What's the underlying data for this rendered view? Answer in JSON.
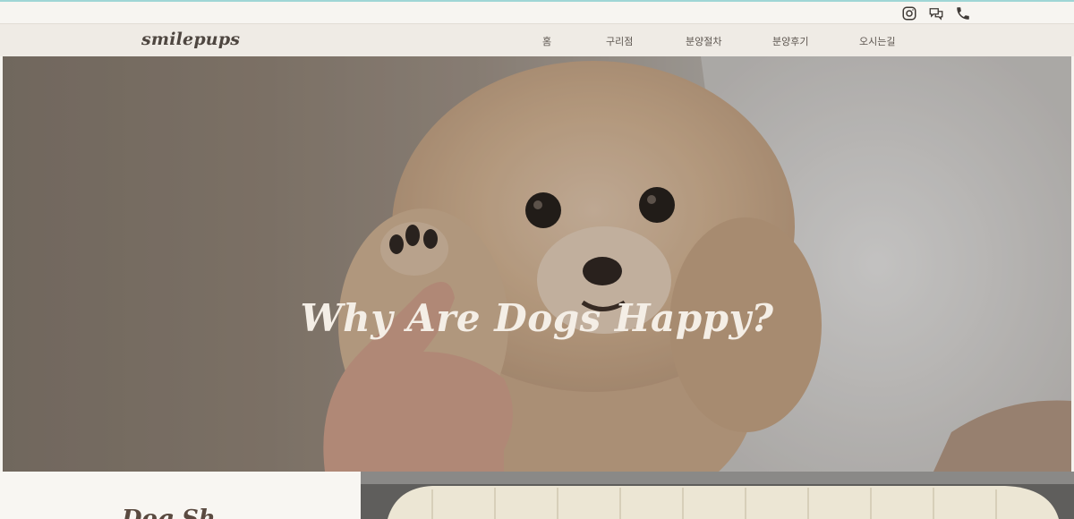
{
  "topbar": {
    "icons": [
      "instagram-icon",
      "chat-icon",
      "phone-icon"
    ]
  },
  "nav": {
    "logo": "smilepups",
    "items": [
      {
        "label": "홈"
      },
      {
        "label": "구리점"
      },
      {
        "label": "분양절차"
      },
      {
        "label": "분양후기"
      },
      {
        "label": "오시는길"
      }
    ]
  },
  "hero": {
    "title": "Why Are Dogs Happy?"
  },
  "section": {
    "heading_partial": "Dog Sh"
  },
  "colors": {
    "nav_bg": "#efebe5",
    "page_bg": "#f6f4ef",
    "text": "#5d5650",
    "hero_title": "#f4eee6"
  }
}
